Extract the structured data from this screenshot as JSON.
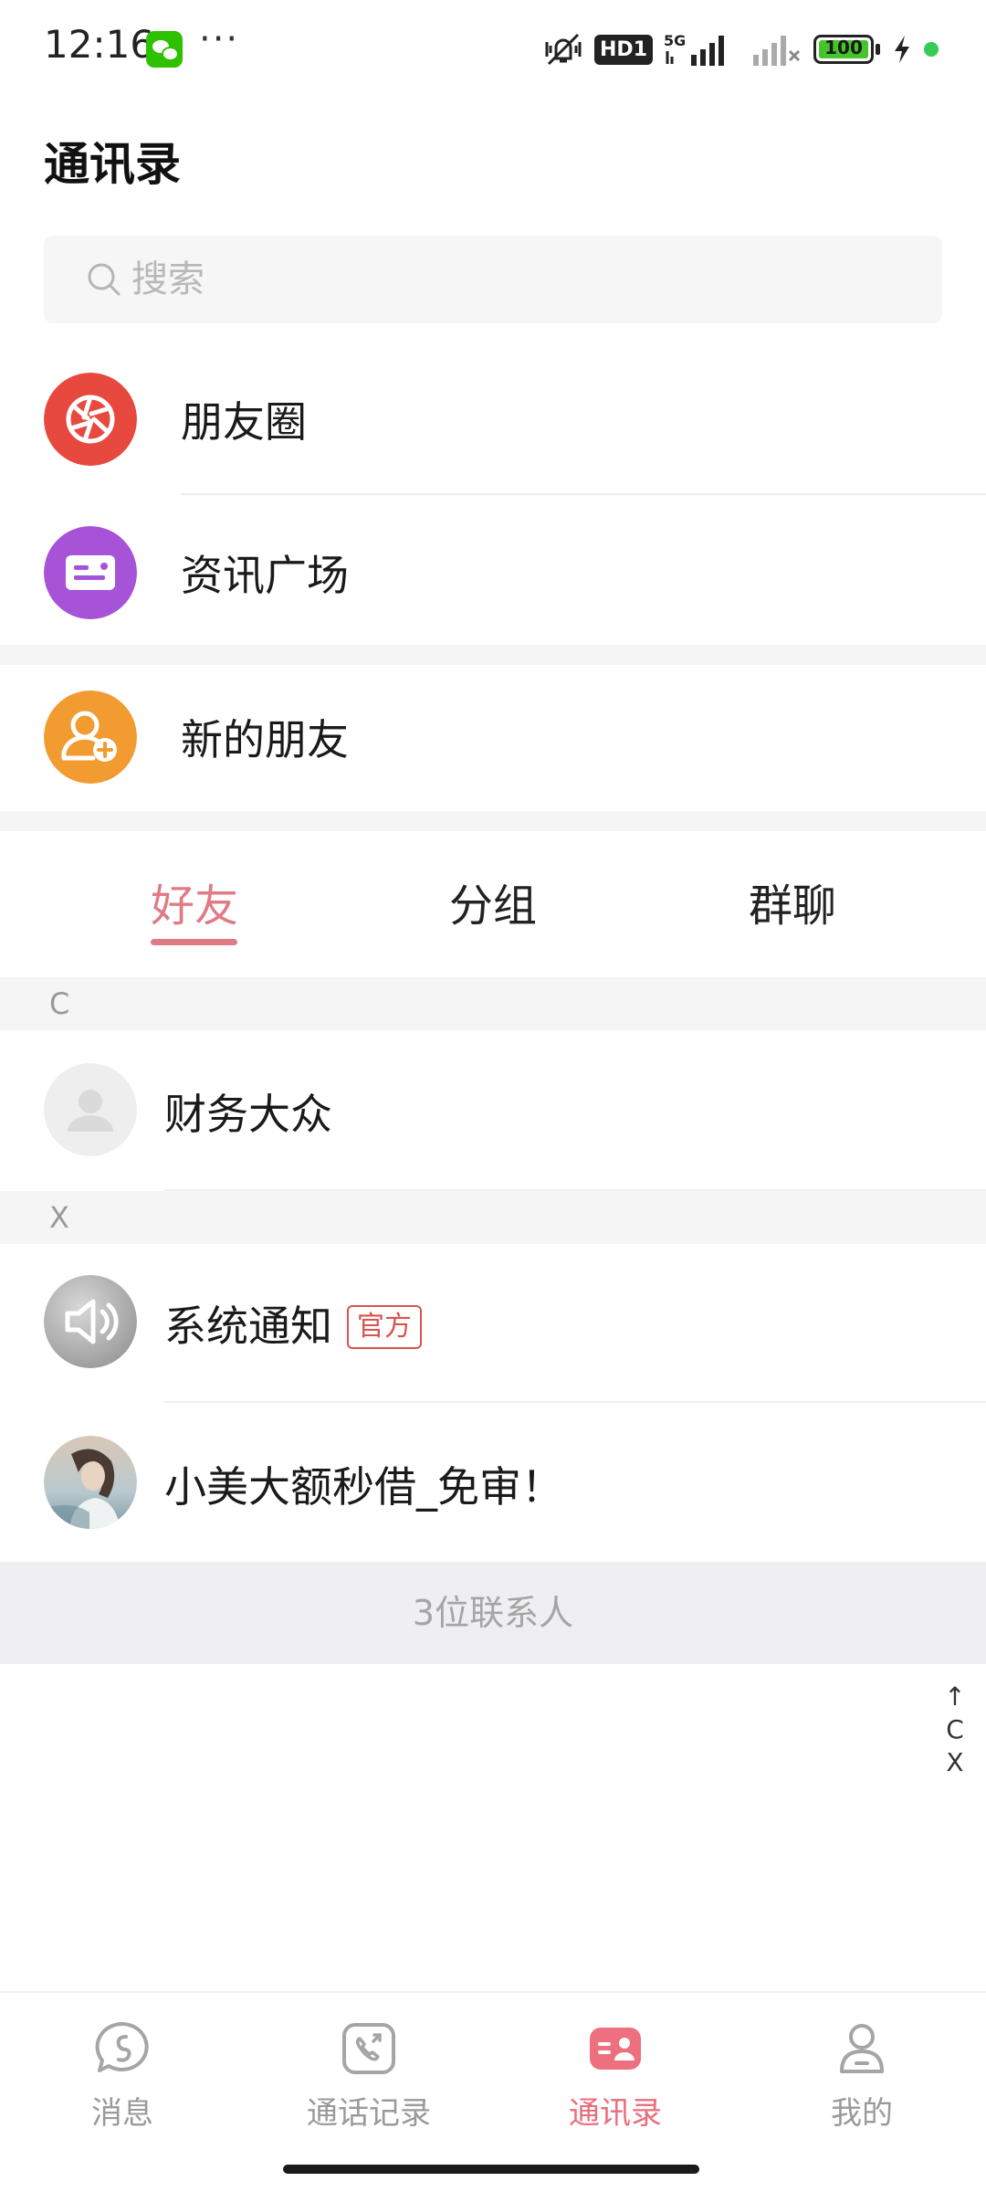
{
  "status_bar": {
    "time": "12:16",
    "dots": "···",
    "network_badge": "HD1",
    "signal_label": "5G",
    "battery": "100"
  },
  "header": {
    "title": "通讯录"
  },
  "search": {
    "placeholder": "搜索",
    "value": ""
  },
  "features": [
    {
      "label": "朋友圈",
      "icon": "camera-shutter-icon",
      "color": "#e8493f"
    },
    {
      "label": "资讯广场",
      "icon": "news-card-icon",
      "color": "#a653d8"
    },
    {
      "label": "新的朋友",
      "icon": "add-friend-icon",
      "color": "#f19b30"
    }
  ],
  "tabs": [
    {
      "label": "好友",
      "active": true
    },
    {
      "label": "分组",
      "active": false
    },
    {
      "label": "群聊",
      "active": false
    }
  ],
  "accent_color": "#e07b86",
  "sections": [
    {
      "letter": "C",
      "contacts": [
        {
          "name": "财务大众",
          "avatar": "default-avatar-icon"
        }
      ]
    },
    {
      "letter": "X",
      "contacts": [
        {
          "name": "系统通知",
          "badge": "官方",
          "avatar": "speaker-icon"
        },
        {
          "name": "小美大额秒借_免审！",
          "avatar": "photo-avatar"
        }
      ]
    }
  ],
  "contact_count": "3位联系人",
  "index_bar": {
    "up": "↑",
    "letters": [
      "C",
      "X"
    ]
  },
  "bottom_nav": [
    {
      "label": "消息",
      "icon": "message-icon",
      "active": false
    },
    {
      "label": "通话记录",
      "icon": "call-log-icon",
      "active": false
    },
    {
      "label": "通讯录",
      "icon": "contacts-icon",
      "active": true
    },
    {
      "label": "我的",
      "icon": "profile-icon",
      "active": false
    }
  ]
}
